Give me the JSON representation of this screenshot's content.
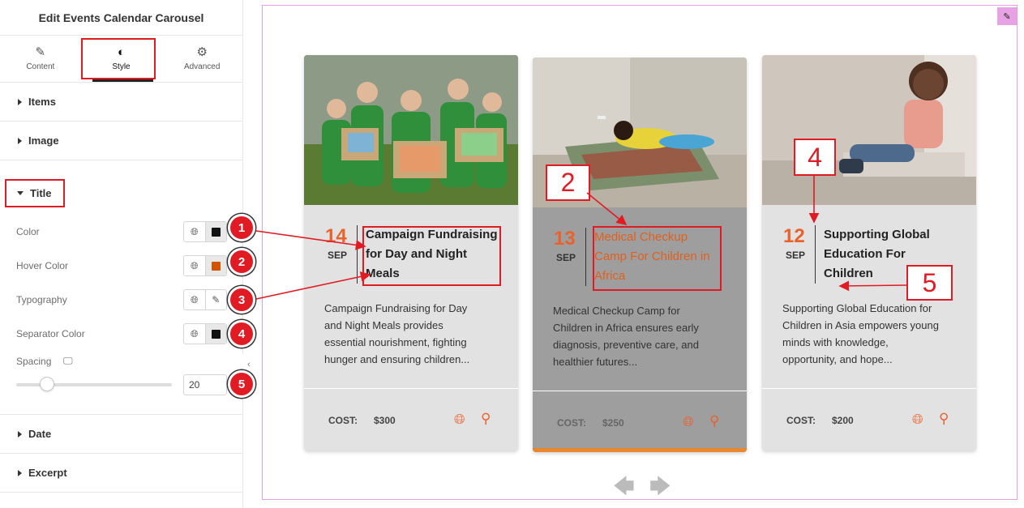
{
  "panel": {
    "title": "Edit Events Calendar Carousel",
    "tabs": [
      {
        "label": "Content",
        "icon": "pencil-icon",
        "glyph": "✎"
      },
      {
        "label": "Style",
        "icon": "contrast-icon",
        "glyph": "◐"
      },
      {
        "label": "Advanced",
        "icon": "gear-icon",
        "glyph": "⚙"
      }
    ],
    "sections": {
      "items": "Items",
      "image": "Image",
      "title": "Title",
      "date": "Date",
      "excerpt": "Excerpt"
    },
    "controls": {
      "color": "Color",
      "hover_color": "Hover Color",
      "typography": "Typography",
      "separator_color": "Separator Color",
      "spacing": "Spacing",
      "spacing_value": "20",
      "color_value": "#111111",
      "hover_color_value": "#d35400",
      "separator_color_value": "#111111",
      "spacing_fraction": 0.2
    },
    "badges": [
      "1",
      "2",
      "3",
      "4",
      "5"
    ]
  },
  "cards": [
    {
      "day": "14",
      "month": "SEP",
      "title": [
        "Campaign Fundraising",
        "for Day and Night",
        "Meals"
      ],
      "excerpt": [
        "Campaign Fundraising for Day",
        "and Night Meals provides",
        "essential nourishment, fighting",
        "hunger and ensuring children..."
      ],
      "cost_label": "COST:",
      "cost_value": "$300"
    },
    {
      "day": "13",
      "month": "SEP",
      "title": [
        "Medical Checkup",
        "Camp For Children in",
        "Africa"
      ],
      "excerpt": [
        "Medical Checkup Camp for",
        "Children in Africa ensures early",
        "diagnosis, preventive care, and",
        "healthier futures..."
      ],
      "cost_label": "COST:",
      "cost_value": "$250"
    },
    {
      "day": "12",
      "month": "SEP",
      "title": [
        "Supporting Global",
        "Education For",
        "Children"
      ],
      "excerpt": [
        "Supporting Global Education for",
        "Children in Asia empowers young",
        "minds with knowledge,",
        "opportunity, and hope..."
      ],
      "cost_label": "COST:",
      "cost_value": "$200"
    }
  ],
  "annotations": [
    "2",
    "4",
    "5"
  ],
  "colors": {
    "accent": "#e8622d",
    "annotation": "#e01b24"
  }
}
